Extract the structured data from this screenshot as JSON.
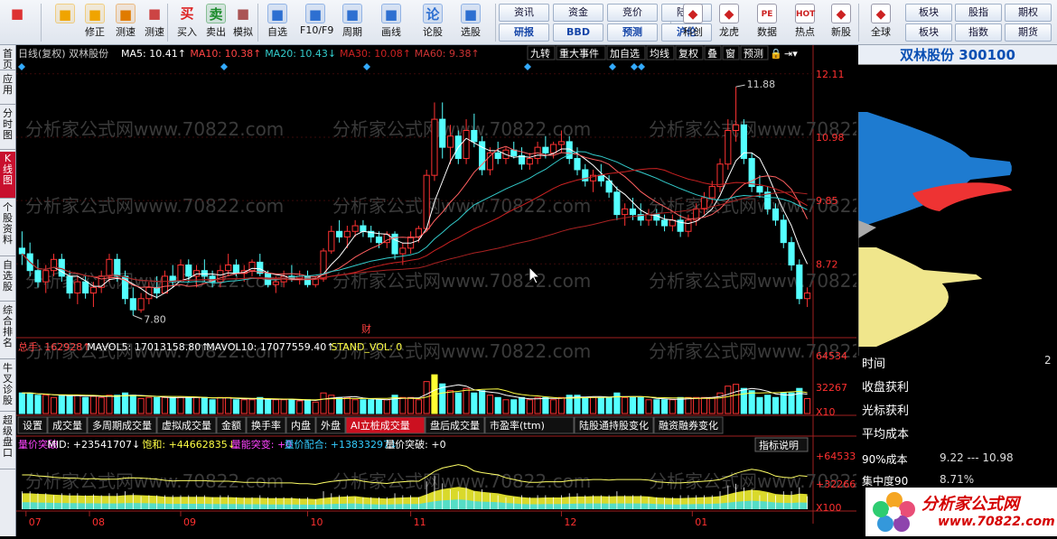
{
  "toolbar": {
    "buttons": [
      {
        "label": "",
        "icon": "app-menu-icon",
        "color": "#d33"
      },
      {
        "label": "",
        "icon": "back-arrow-icon",
        "color": "#f0a400"
      },
      {
        "label": "修正",
        "icon": "up-down-icon",
        "color": "#f0a400"
      },
      {
        "label": "测速",
        "icon": "power-icon",
        "color": "#e07b00"
      },
      {
        "label": "测速",
        "icon": "clock-icon",
        "color": "#c44"
      },
      {
        "label": "买入",
        "icon": "buy-icon",
        "glyph": "买",
        "color": "#d22"
      },
      {
        "label": "卖出",
        "icon": "sell-icon",
        "glyph": "卖",
        "color": "#1a8a2a"
      },
      {
        "label": "模拟",
        "icon": "hammer-icon",
        "color": "#a55"
      },
      {
        "label": "自选",
        "icon": "star-icon",
        "color": "#2d6fd1"
      },
      {
        "label": "F10/F9",
        "icon": "f10-icon",
        "color": "#2d6fd1"
      },
      {
        "label": "周期",
        "icon": "period-icon",
        "color": "#2d6fd1"
      },
      {
        "label": "画线",
        "icon": "pencil-icon",
        "color": "#2d6fd1"
      },
      {
        "label": "论股",
        "icon": "discuss-icon",
        "glyph": "论",
        "color": "#2d6fd1"
      },
      {
        "label": "选股",
        "icon": "select-icon",
        "color": "#2d6fd1"
      }
    ],
    "text_buttons_row1": [
      "资讯",
      "资金",
      "竞价",
      "陆港"
    ],
    "text_buttons_row2": [
      "研报",
      "BBD",
      "预测",
      "沪伦"
    ],
    "buttons2": [
      {
        "label": "科创",
        "icon": "chart-icon"
      },
      {
        "label": "龙虎",
        "icon": "dragon-icon"
      },
      {
        "label": "数据",
        "icon": "pe-icon",
        "glyph": "PE"
      },
      {
        "label": "热点",
        "icon": "hot-icon",
        "glyph": "HOT"
      },
      {
        "label": "新股",
        "icon": "new-stock-icon"
      },
      {
        "label": "全球",
        "icon": "globe-icon"
      }
    ],
    "right_row1": [
      "板块",
      "股指",
      "期权"
    ],
    "right_row2": [
      "板块",
      "指数",
      "期货"
    ]
  },
  "left_tabs": [
    "首页",
    "应用",
    "分时图",
    "K线图",
    "个股资料",
    "自选股",
    "综合排名",
    "牛叉诊股",
    "超级盘口"
  ],
  "chart": {
    "header_left": "日线(复权)  双林股份",
    "ma": [
      {
        "text": "MA5: 10.41↑",
        "color": "#ffffff"
      },
      {
        "text": "MA10: 10.38↑",
        "color": "#ff4444"
      },
      {
        "text": "MA20: 10.43↓",
        "color": "#33cccc"
      },
      {
        "text": "MA30: 10.08↑",
        "color": "#cc2222"
      },
      {
        "text": "MA60: 9.38↑",
        "color": "#cc3333"
      }
    ],
    "header_buttons": [
      "九转",
      "重大事件",
      "加自选",
      "均线",
      "复权",
      "叠",
      "窗",
      "预测"
    ],
    "price_axis": [
      "12.11",
      "10.98",
      "9.85",
      "8.72"
    ],
    "high_label": "11.88",
    "low_label": "7.80",
    "event_label": "财",
    "volume_header": [
      {
        "text": "总手: 162928↑",
        "color": "#ff4444"
      },
      {
        "text": "MAVOL5: 17013158.80↑",
        "color": "#ffffff"
      },
      {
        "text": "MAVOL10: 17077559.40↑",
        "color": "#ffffff"
      },
      {
        "text": "STAND_VOL: 0",
        "color": "#ffff44"
      }
    ],
    "volume_axis": [
      "64534",
      "32267",
      "X10"
    ],
    "indicator_tabs": [
      "设置",
      "成交量",
      "多周期成交量",
      "虚拟成交量",
      "金额",
      "换手率",
      "内盘",
      "外盘",
      "AI立桩成交量",
      "盘后成交量",
      "市盈率(ttm)",
      "陆股通持股变化",
      "融资融券变化"
    ],
    "active_tab": "AI立桩成交量",
    "ind_header": [
      {
        "text": "量价突破",
        "color": "#ff44ff"
      },
      {
        "text": "MID: +23541707↓",
        "color": "#ffffff"
      },
      {
        "text": "饱和: +44662835↓",
        "color": "#ffff44"
      },
      {
        "text": "量能突变: +0",
        "color": "#ff44ff"
      },
      {
        "text": "量价配合: +13833297↓",
        "color": "#33ccff"
      },
      {
        "text": "量价突破: +0",
        "color": "#ffffff"
      }
    ],
    "ind_button": "指标说明",
    "ind_axis": [
      "+645335",
      "+322668",
      "X100"
    ],
    "months": [
      "07",
      "08",
      "09",
      "10",
      "11",
      "12",
      "01"
    ],
    "watermark": "分析家公式网www.70822.com"
  },
  "right_panel": {
    "title": "双林股份 300100",
    "rows": [
      {
        "label": "时间",
        "value": "2"
      },
      {
        "label": "收盘获利",
        "value": ""
      },
      {
        "label": "光标获利",
        "value": ""
      },
      {
        "label": "平均成本",
        "value": ""
      },
      {
        "label": "90%成本",
        "value": "9.22 ---    10.98"
      },
      {
        "label": "集中度90",
        "value": "8.71%"
      }
    ]
  },
  "logo": {
    "text": "分析家公式网",
    "url": "www.70822.com"
  },
  "chart_data": {
    "type": "candlestick",
    "title": "双林股份 日线(复权)",
    "ylim": [
      7.5,
      12.3
    ],
    "months": [
      "07",
      "08",
      "09",
      "10",
      "11",
      "12",
      "01"
    ],
    "ohlc": [
      [
        9.0,
        9.3,
        8.7,
        8.9
      ],
      [
        8.9,
        9.1,
        8.5,
        8.6
      ],
      [
        8.6,
        8.8,
        8.3,
        8.4
      ],
      [
        8.4,
        8.7,
        8.2,
        8.6
      ],
      [
        8.6,
        8.9,
        8.5,
        8.8
      ],
      [
        8.8,
        8.9,
        8.4,
        8.5
      ],
      [
        8.5,
        8.6,
        8.1,
        8.2
      ],
      [
        8.2,
        8.5,
        8.0,
        8.4
      ],
      [
        8.4,
        8.5,
        8.1,
        8.2
      ],
      [
        8.2,
        8.4,
        7.95,
        8.3
      ],
      [
        8.3,
        8.6,
        8.2,
        8.5
      ],
      [
        8.5,
        8.9,
        8.4,
        8.8
      ],
      [
        8.8,
        8.9,
        8.4,
        8.5
      ],
      [
        8.5,
        8.6,
        8.0,
        8.1
      ],
      [
        8.1,
        8.3,
        7.8,
        7.9
      ],
      [
        7.9,
        8.2,
        7.85,
        8.1
      ],
      [
        8.1,
        8.4,
        8.0,
        8.3
      ],
      [
        8.3,
        8.5,
        8.1,
        8.2
      ],
      [
        8.2,
        8.6,
        8.2,
        8.5
      ],
      [
        8.5,
        8.7,
        8.3,
        8.4
      ],
      [
        8.4,
        8.8,
        8.4,
        8.7
      ],
      [
        8.7,
        8.8,
        8.4,
        8.5
      ],
      [
        8.5,
        8.7,
        8.3,
        8.6
      ],
      [
        8.6,
        8.8,
        8.4,
        8.5
      ],
      [
        8.5,
        8.6,
        8.3,
        8.4
      ],
      [
        8.4,
        8.7,
        8.3,
        8.6
      ],
      [
        8.6,
        8.9,
        8.5,
        8.7
      ],
      [
        8.7,
        8.8,
        8.5,
        8.55
      ],
      [
        8.55,
        8.7,
        8.4,
        8.6
      ],
      [
        8.6,
        8.8,
        8.5,
        8.75
      ],
      [
        8.75,
        8.9,
        8.5,
        8.55
      ],
      [
        8.55,
        8.6,
        8.3,
        8.35
      ],
      [
        8.35,
        8.5,
        8.2,
        8.4
      ],
      [
        8.4,
        8.6,
        8.3,
        8.5
      ],
      [
        8.5,
        8.7,
        8.4,
        8.45
      ],
      [
        8.45,
        8.6,
        8.35,
        8.5
      ],
      [
        8.5,
        8.6,
        8.3,
        8.35
      ],
      [
        8.35,
        8.5,
        8.3,
        8.45
      ],
      [
        8.45,
        9.0,
        8.4,
        8.95
      ],
      [
        8.95,
        9.4,
        8.9,
        9.3
      ],
      [
        9.3,
        9.5,
        9.1,
        9.2
      ],
      [
        9.2,
        9.4,
        9.0,
        9.3
      ],
      [
        9.3,
        9.5,
        9.2,
        9.4
      ],
      [
        9.4,
        9.5,
        9.2,
        9.3
      ],
      [
        9.3,
        9.4,
        9.1,
        9.2
      ],
      [
        9.2,
        9.3,
        9.0,
        9.1
      ],
      [
        9.1,
        9.3,
        9.0,
        9.25
      ],
      [
        9.25,
        9.3,
        8.8,
        8.9
      ],
      [
        8.9,
        9.1,
        8.7,
        9.0
      ],
      [
        9.0,
        9.3,
        8.9,
        9.2
      ],
      [
        9.2,
        9.4,
        9.1,
        9.35
      ],
      [
        9.35,
        10.4,
        9.3,
        10.3
      ],
      [
        10.3,
        11.6,
        10.2,
        11.3
      ],
      [
        11.3,
        11.6,
        10.6,
        10.8
      ],
      [
        10.8,
        11.2,
        10.5,
        11.0
      ],
      [
        11.0,
        11.1,
        10.5,
        10.6
      ],
      [
        10.6,
        11.3,
        10.5,
        11.1
      ],
      [
        11.1,
        11.4,
        10.8,
        10.9
      ],
      [
        10.9,
        11.0,
        10.3,
        10.4
      ],
      [
        10.4,
        10.8,
        10.3,
        10.7
      ],
      [
        10.7,
        10.9,
        10.5,
        10.6
      ],
      [
        10.6,
        10.8,
        10.5,
        10.75
      ],
      [
        10.75,
        10.9,
        10.6,
        10.65
      ],
      [
        10.65,
        10.8,
        10.4,
        10.5
      ],
      [
        10.5,
        10.7,
        10.4,
        10.6
      ],
      [
        10.6,
        10.9,
        10.5,
        10.8
      ],
      [
        10.8,
        11.0,
        10.6,
        10.7
      ],
      [
        10.7,
        10.9,
        10.6,
        10.85
      ],
      [
        10.85,
        11.1,
        10.7,
        10.9
      ],
      [
        10.9,
        11.0,
        10.5,
        10.6
      ],
      [
        10.6,
        10.8,
        10.3,
        10.4
      ],
      [
        10.4,
        10.5,
        10.1,
        10.2
      ],
      [
        10.2,
        10.4,
        10.0,
        10.3
      ],
      [
        10.3,
        10.5,
        10.1,
        10.2
      ],
      [
        10.2,
        10.3,
        9.9,
        10.0
      ],
      [
        10.0,
        10.1,
        9.5,
        9.6
      ],
      [
        9.6,
        9.8,
        9.4,
        9.7
      ],
      [
        9.7,
        9.9,
        9.5,
        9.6
      ],
      [
        9.6,
        9.8,
        9.4,
        9.5
      ],
      [
        9.5,
        9.7,
        9.4,
        9.6
      ],
      [
        9.6,
        9.7,
        9.4,
        9.5
      ],
      [
        9.5,
        9.6,
        9.3,
        9.4
      ],
      [
        9.4,
        9.6,
        9.3,
        9.5
      ],
      [
        9.5,
        9.6,
        9.2,
        9.3
      ],
      [
        9.3,
        9.6,
        9.2,
        9.5
      ],
      [
        9.5,
        9.8,
        9.4,
        9.7
      ],
      [
        9.7,
        10.0,
        9.6,
        9.9
      ],
      [
        9.9,
        10.2,
        9.8,
        10.1
      ],
      [
        10.1,
        10.6,
        10.0,
        10.5
      ],
      [
        10.5,
        11.3,
        10.4,
        11.1
      ],
      [
        11.1,
        11.88,
        10.9,
        11.2
      ],
      [
        11.2,
        11.3,
        10.5,
        10.6
      ],
      [
        10.6,
        10.7,
        10.0,
        10.1
      ],
      [
        10.1,
        10.3,
        9.9,
        10.0
      ],
      [
        10.0,
        10.1,
        9.6,
        9.7
      ],
      [
        9.7,
        9.8,
        9.4,
        9.5
      ],
      [
        9.5,
        9.6,
        9.0,
        9.1
      ],
      [
        9.1,
        9.2,
        8.6,
        8.7
      ],
      [
        8.7,
        8.8,
        8.0,
        8.1
      ],
      [
        8.1,
        8.3,
        7.95,
        8.2
      ]
    ],
    "volume_axis_max": 64534,
    "price_axis_ticks": [
      12.11,
      10.98,
      9.85,
      8.72
    ]
  }
}
